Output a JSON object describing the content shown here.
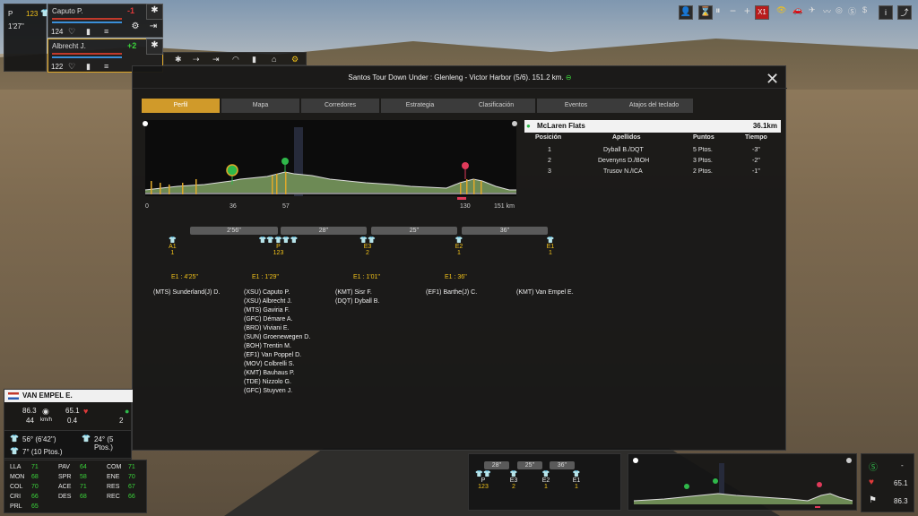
{
  "header": {
    "title": "Santos Tour Down Under : Glenleng - Victor Harbor (5/6). 151.2 km."
  },
  "tabs": [
    "Perfil",
    "Mapa",
    "Corredores",
    "Estrategia",
    "Clasificación",
    "Eventos",
    "Atajos del teclado"
  ],
  "topleft": {
    "group": "P",
    "count": "123",
    "time": "1'27''"
  },
  "riders": [
    {
      "name": "Caputo P.",
      "diff": "-1",
      "value": "124",
      "color": "#e03a3a"
    },
    {
      "name": "Albrecht J.",
      "diff": "+2",
      "value": "122",
      "color": "#3ad43a"
    }
  ],
  "profile": {
    "km_labels": [
      "0",
      "36",
      "57",
      "130",
      "151 km"
    ]
  },
  "sprint": {
    "name": "McLaren Flats",
    "distance": "36.1km",
    "cols": [
      "Posición",
      "Apellidos",
      "Puntos",
      "Tiempo"
    ],
    "rows": [
      [
        "1",
        "Dyball B./DQT",
        "5 Ptos.",
        "-3''"
      ],
      [
        "2",
        "Devenyns D./BOH",
        "3 Ptos.",
        "-2''"
      ],
      [
        "3",
        "Trusov N./ICA",
        "2 Ptos.",
        "-1''"
      ]
    ]
  },
  "gaps": [
    "2'56''",
    "28''",
    "25''",
    "36''"
  ],
  "groups": [
    {
      "label": "A1",
      "count": "1",
      "gap": "E1 : 4'25''",
      "riders": [
        "(MTS) Sunderland(J) D."
      ]
    },
    {
      "label": "P",
      "count": "123",
      "gap": "E1 : 1'29''",
      "riders": [
        "(XSU) Caputo P.",
        "(XSU) Albrecht J.",
        "(MTS) Gaviria F.",
        "(GFC) Démare A.",
        "(BRD) Viviani E.",
        "(SUN) Groenewegen D.",
        "(BOH) Trentin M.",
        "(EF1) Van Poppel D.",
        "(MOV) Colbrelli S.",
        "(KMT) Bauhaus P.",
        "(TDE) Nizzolo G.",
        "(GFC) Stuyven J."
      ]
    },
    {
      "label": "E3",
      "count": "2",
      "gap": "E1 : 1'01''",
      "riders": [
        "(KMT) Sisr F.",
        "(DQT) Dyball B."
      ]
    },
    {
      "label": "E2",
      "count": "1",
      "gap": "E1 : 36''",
      "riders": [
        "(EF1) Barthe(J) C."
      ]
    },
    {
      "label": "E1",
      "count": "1",
      "gap": "",
      "riders": [
        "(KMT) Van Empel E."
      ]
    }
  ],
  "riderPanel": {
    "name": "VAN EMPEL E.",
    "speed": "44",
    "speed_unit": "km/h",
    "v1": "86.3",
    "v2": "65.1",
    "v3": "0.4",
    "v4": "2",
    "j1": "56° (6'42'')",
    "j2": "24° (5 Ptos.)",
    "j3": "7° (10 Ptos.)",
    "stats": [
      [
        "LLA",
        "71",
        "PAV",
        "64",
        "COM",
        "71"
      ],
      [
        "MON",
        "68",
        "SPR",
        "58",
        "ENE",
        "70"
      ],
      [
        "COL",
        "70",
        "ACE",
        "71",
        "RES",
        "67"
      ],
      [
        "CRI",
        "66",
        "DES",
        "68",
        "REC",
        "66"
      ],
      [
        "PRL",
        "65",
        "",
        "",
        "",
        ""
      ]
    ]
  },
  "mini": {
    "gaps": [
      "28''",
      "25''",
      "36''"
    ],
    "groups": [
      [
        "P",
        "123"
      ],
      [
        "E3",
        "2"
      ],
      [
        "E2",
        "1"
      ],
      [
        "E1",
        "1"
      ]
    ]
  },
  "rightbox": {
    "v1": "65.1",
    "v2": "86.3",
    "dash": "-"
  }
}
